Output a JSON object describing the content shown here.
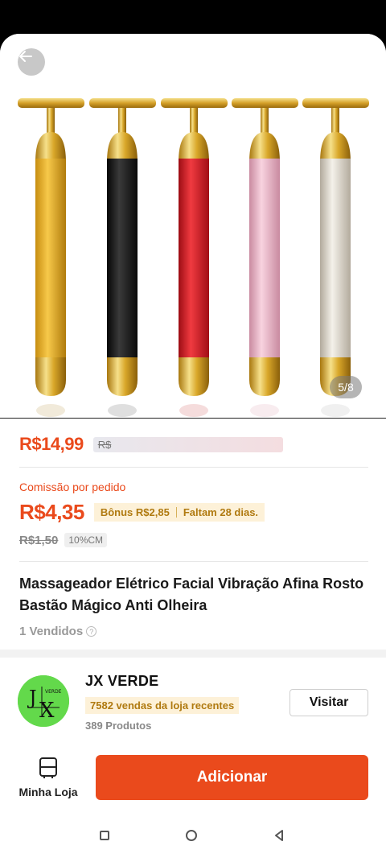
{
  "hero": {
    "image_counter": "5/8",
    "rollers": [
      {
        "color": "gold",
        "body": "#e3a91b"
      },
      {
        "color": "black",
        "body": "#1b1b1b"
      },
      {
        "color": "red",
        "body": "#d11a22"
      },
      {
        "color": "pink",
        "body": "#e6a8bd"
      },
      {
        "color": "silver",
        "body": "#d8d2c6"
      }
    ]
  },
  "price": {
    "current": "R$14,99",
    "original": "R$"
  },
  "commission": {
    "label": "Comissão por pedido",
    "value": "R$4,35",
    "bonus": "Bônus R$2,85",
    "days_left": "Faltam 28 dias.",
    "old_value": "R$1,50",
    "rate": "10%CM"
  },
  "product": {
    "title": "Massageador Elétrico Facial Vibração Afina Rosto Bastão Mágico Anti Olheira",
    "sold": "1 Vendidos"
  },
  "store": {
    "name": "JX VERDE",
    "recent_sales": "7582 vendas da loja recentes",
    "products": "389 Produtos",
    "visit_label": "Visitar",
    "logo_text": "JX",
    "logo_subtext": "VERDE"
  },
  "actions": {
    "my_store_label": "Minha Loja",
    "add_label": "Adicionar"
  },
  "colors": {
    "accent": "#ea4a1c",
    "store_logo_bg": "#63d94b",
    "chip_bg": "#fdf1d8",
    "chip_text": "#b07a10"
  }
}
